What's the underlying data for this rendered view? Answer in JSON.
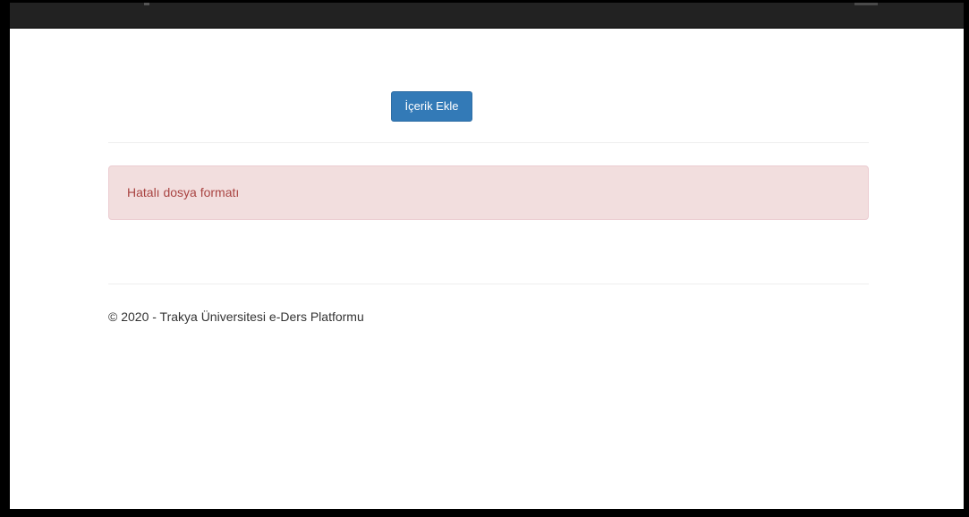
{
  "main": {
    "add_content_button_label": "İçerik Ekle"
  },
  "alert": {
    "message": "Hatalı dosya formatı"
  },
  "footer": {
    "copyright": "© 2020 - Trakya Üniversitesi e-Ders Platformu"
  },
  "colors": {
    "navbar": "#222222",
    "primary_button": "#337ab7",
    "alert_background": "#f2dede",
    "alert_text": "#a94442"
  }
}
